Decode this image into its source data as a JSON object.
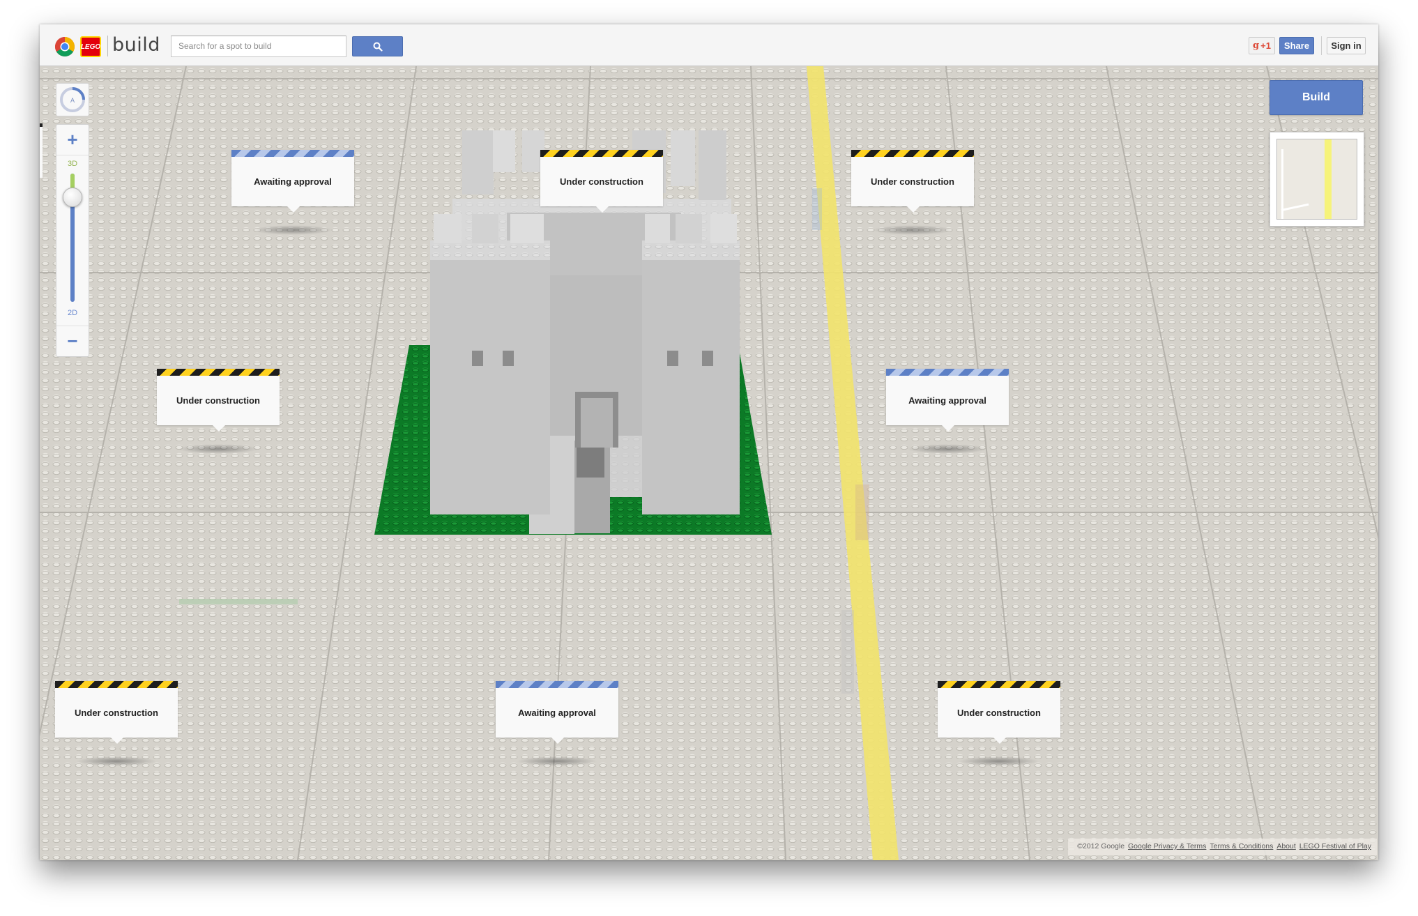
{
  "header": {
    "app_title": "build",
    "lego_logo_text": "LEGO",
    "search_placeholder": "Search for a spot to build",
    "gplus_label": "+1",
    "share_label": "Share",
    "signin_label": "Sign in"
  },
  "map_controls": {
    "compass_label": "A",
    "zoom_in": "+",
    "zoom_out": "−",
    "label_3d": "3D",
    "label_2d": "2D",
    "zoom_slider_level_percent": 85
  },
  "build_button": "Build",
  "plot_tags": [
    {
      "status": "approval",
      "label": "Awaiting approval"
    },
    {
      "status": "construction",
      "label": "Under construction"
    },
    {
      "status": "construction",
      "label": "Under construction"
    },
    {
      "status": "construction",
      "label": "Under construction"
    },
    {
      "status": "approval",
      "label": "Awaiting approval"
    },
    {
      "status": "construction",
      "label": "Under construction"
    },
    {
      "status": "approval",
      "label": "Awaiting approval"
    },
    {
      "status": "construction",
      "label": "Under construction"
    }
  ],
  "footer": {
    "copyright": "©2012 Google",
    "links": [
      "Google Privacy & Terms",
      "Terms & Conditions",
      "About",
      "LEGO Festival of Play"
    ]
  },
  "colors": {
    "accent_blue": "#5d80c6",
    "baseplate_green": "#0c7a26",
    "road_yellow": "#f2e36b",
    "baseplate_grey": "#d7d4cd",
    "construction_yellow": "#ffd21f"
  }
}
